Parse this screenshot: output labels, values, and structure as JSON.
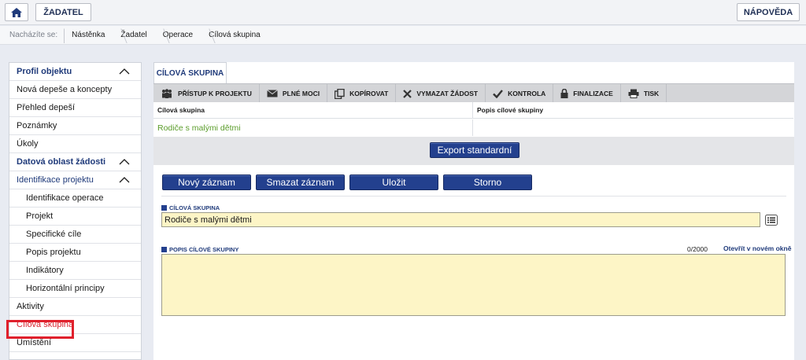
{
  "topbar": {
    "home_icon": "home-icon",
    "applicant_label": "ŽADATEL",
    "help_label": "NÁPOVĚDA"
  },
  "breadcrumb": {
    "label": "Nacházíte se:",
    "items": [
      "Nástěnka",
      "Žadatel",
      "Operace",
      "Cílová skupina"
    ]
  },
  "sidebar": {
    "items": [
      {
        "label": "Profil objektu",
        "type": "head",
        "expanded": true
      },
      {
        "label": "Nová depeše a koncepty",
        "type": "item"
      },
      {
        "label": "Přehled depeší",
        "type": "item"
      },
      {
        "label": "Poznámky",
        "type": "item"
      },
      {
        "label": "Úkoly",
        "type": "item"
      },
      {
        "label": "Datová oblast žádosti",
        "type": "head",
        "expanded": true
      },
      {
        "label": "Identifikace projektu",
        "type": "subhead",
        "expanded": true
      },
      {
        "label": "Identifikace operace",
        "type": "sub"
      },
      {
        "label": "Projekt",
        "type": "sub"
      },
      {
        "label": "Specifické cíle",
        "type": "sub"
      },
      {
        "label": "Popis projektu",
        "type": "sub"
      },
      {
        "label": "Indikátory",
        "type": "sub"
      },
      {
        "label": "Horizontální principy",
        "type": "sub"
      },
      {
        "label": "Aktivity",
        "type": "item"
      },
      {
        "label": "Cílová skupina",
        "type": "item",
        "active": true
      },
      {
        "label": "Umístění",
        "type": "item"
      }
    ]
  },
  "main": {
    "tab_label": "CÍLOVÁ SKUPINA",
    "toolbar": [
      {
        "label": "PŘÍSTUP K PROJEKTU",
        "icon": "people-icon"
      },
      {
        "label": "PLNÉ MOCI",
        "icon": "mail-icon"
      },
      {
        "label": "KOPÍROVAT",
        "icon": "copy-icon"
      },
      {
        "label": "VYMAZAT ŽÁDOST",
        "icon": "close-icon"
      },
      {
        "label": "KONTROLA",
        "icon": "check-icon"
      },
      {
        "label": "FINALIZACE",
        "icon": "lock-icon"
      },
      {
        "label": "TISK",
        "icon": "printer-icon"
      }
    ],
    "grid": {
      "columns": [
        "Cílová skupina",
        "Popis cílové skupiny"
      ],
      "rows": [
        [
          "Rodiče s malými dětmi",
          ""
        ]
      ]
    },
    "export_label": "Export standardní",
    "actions": {
      "new": "Nový záznam",
      "delete": "Smazat záznam",
      "save": "Uložit",
      "cancel": "Storno"
    },
    "form": {
      "group_label": "CÍLOVÁ SKUPINA",
      "group_value": "Rodiče s malými dětmi",
      "desc_label": "POPIS CÍLOVÉ SKUPINY",
      "desc_value": "",
      "counter": "0/2000",
      "open_link": "Otevřít v novém okně"
    }
  },
  "colors": {
    "accent": "#23408e",
    "active_highlight": "#e0202c",
    "input_bg": "#fdf5c6",
    "grid_value": "#5a9c2a"
  }
}
